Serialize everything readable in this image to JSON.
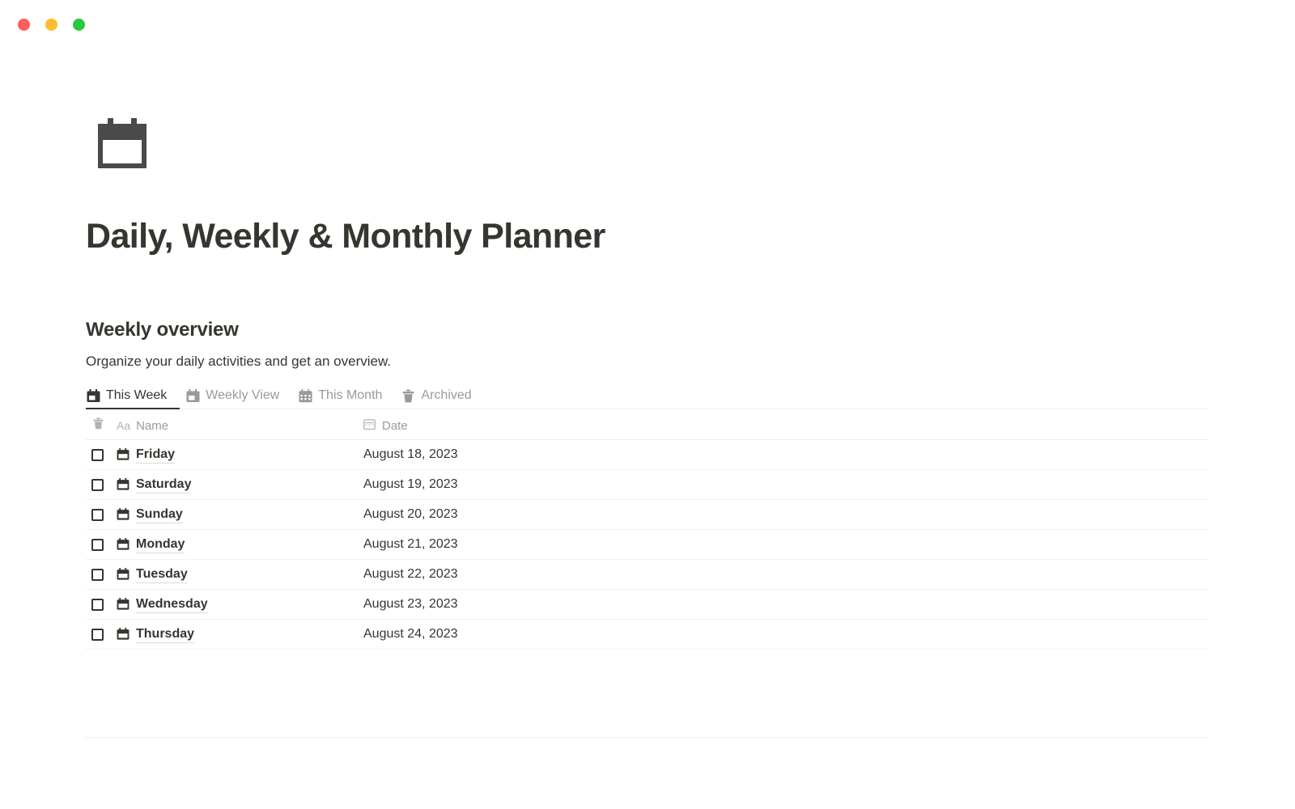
{
  "window": {
    "traffic_lights": [
      {
        "name": "close",
        "color": "#ff5f57"
      },
      {
        "name": "minimize",
        "color": "#febc2e"
      },
      {
        "name": "maximize",
        "color": "#28c840"
      }
    ]
  },
  "page": {
    "icon": "calendar-icon",
    "title": "Daily, Weekly & Monthly Planner"
  },
  "section": {
    "heading": "Weekly overview",
    "subtitle": "Organize your daily activities and get an overview."
  },
  "tabs": [
    {
      "label": "This Week",
      "icon": "calendar-icon",
      "active": true
    },
    {
      "label": "Weekly View",
      "icon": "calendar-icon",
      "active": false
    },
    {
      "label": "This Month",
      "icon": "calendar-grid-icon",
      "active": false
    },
    {
      "label": "Archived",
      "icon": "trash-icon",
      "active": false
    }
  ],
  "table": {
    "header": {
      "select_icon": "trash-icon",
      "name_prefix": "Aa",
      "name_label": "Name",
      "date_icon": "date-icon",
      "date_label": "Date"
    },
    "rows": [
      {
        "checked": false,
        "icon": "calendar-icon",
        "name": "Friday",
        "date": "August 18, 2023"
      },
      {
        "checked": false,
        "icon": "calendar-icon",
        "name": "Saturday",
        "date": "August 19, 2023"
      },
      {
        "checked": false,
        "icon": "calendar-icon",
        "name": "Sunday",
        "date": "August 20, 2023"
      },
      {
        "checked": false,
        "icon": "calendar-icon",
        "name": "Monday",
        "date": "August 21, 2023"
      },
      {
        "checked": false,
        "icon": "calendar-icon",
        "name": "Tuesday",
        "date": "August 22, 2023"
      },
      {
        "checked": false,
        "icon": "calendar-icon",
        "name": "Wednesday",
        "date": "August 23, 2023"
      },
      {
        "checked": false,
        "icon": "calendar-icon",
        "name": "Thursday",
        "date": "August 24, 2023"
      }
    ]
  },
  "colors": {
    "text_primary": "#37352f",
    "text_muted": "#9b9a97",
    "divider": "#ededec",
    "icon_dark": "#4a4a4a"
  }
}
